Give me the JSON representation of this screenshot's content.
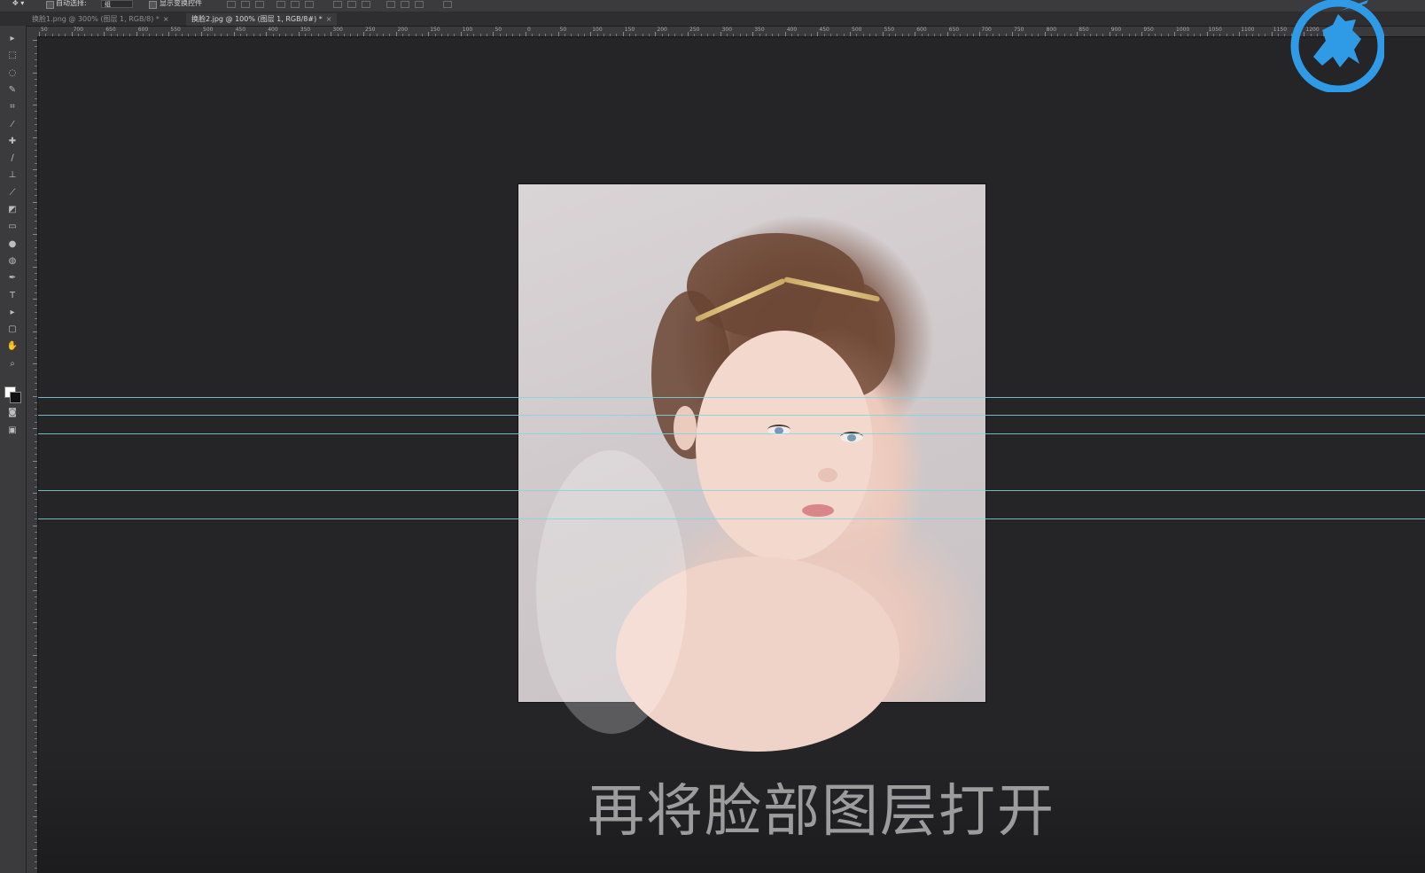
{
  "options_bar": {
    "auto_select_label": "自动选择:",
    "auto_select_value": "组",
    "show_transform_label": "显示变换控件"
  },
  "tabs": [
    {
      "label": "换脸1.png @ 300% (图层 1, RGB/8) *",
      "close": "×",
      "active": false
    },
    {
      "label": "换脸2.jpg @ 100% (图层 1, RGB/8#) *",
      "close": "×",
      "active": true
    }
  ],
  "ruler": {
    "labels": [
      "50",
      "700",
      "650",
      "600",
      "550",
      "500",
      "450",
      "400",
      "350",
      "300",
      "250",
      "200",
      "150",
      "100",
      "50",
      "0",
      "50",
      "100",
      "150",
      "200",
      "250",
      "300",
      "350",
      "400",
      "450",
      "500",
      "550",
      "600",
      "650",
      "700",
      "750",
      "800",
      "850",
      "900",
      "950",
      "1000",
      "1050",
      "1100",
      "1150",
      "1200"
    ]
  },
  "tools": [
    {
      "icon": "move-tool-icon",
      "glyph": "▸"
    },
    {
      "icon": "marquee-tool-icon",
      "glyph": "⬚"
    },
    {
      "icon": "lasso-tool-icon",
      "glyph": "◌"
    },
    {
      "icon": "quick-select-tool-icon",
      "glyph": "✎"
    },
    {
      "icon": "crop-tool-icon",
      "glyph": "⌗"
    },
    {
      "icon": "eyedropper-tool-icon",
      "glyph": "⁄"
    },
    {
      "icon": "healing-brush-tool-icon",
      "glyph": "✚"
    },
    {
      "icon": "brush-tool-icon",
      "glyph": "∕"
    },
    {
      "icon": "clone-stamp-tool-icon",
      "glyph": "⊥"
    },
    {
      "icon": "history-brush-tool-icon",
      "glyph": "⟋"
    },
    {
      "icon": "eraser-tool-icon",
      "glyph": "◩"
    },
    {
      "icon": "gradient-tool-icon",
      "glyph": "▭"
    },
    {
      "icon": "blur-tool-icon",
      "glyph": "●"
    },
    {
      "icon": "dodge-tool-icon",
      "glyph": "◍"
    },
    {
      "icon": "pen-tool-icon",
      "glyph": "✒"
    },
    {
      "icon": "type-tool-icon",
      "glyph": "T"
    },
    {
      "icon": "path-select-tool-icon",
      "glyph": "▸"
    },
    {
      "icon": "shape-tool-icon",
      "glyph": "▢"
    },
    {
      "icon": "hand-tool-icon",
      "glyph": "✋"
    },
    {
      "icon": "zoom-tool-icon",
      "glyph": "⌕"
    }
  ],
  "subtitle": "再将脸部图层打开",
  "colors": {
    "canvas_bg": "#252528",
    "panel_bg": "#3b3b3d",
    "guide": "#7fd5e3",
    "logo": "#2f9be6"
  }
}
